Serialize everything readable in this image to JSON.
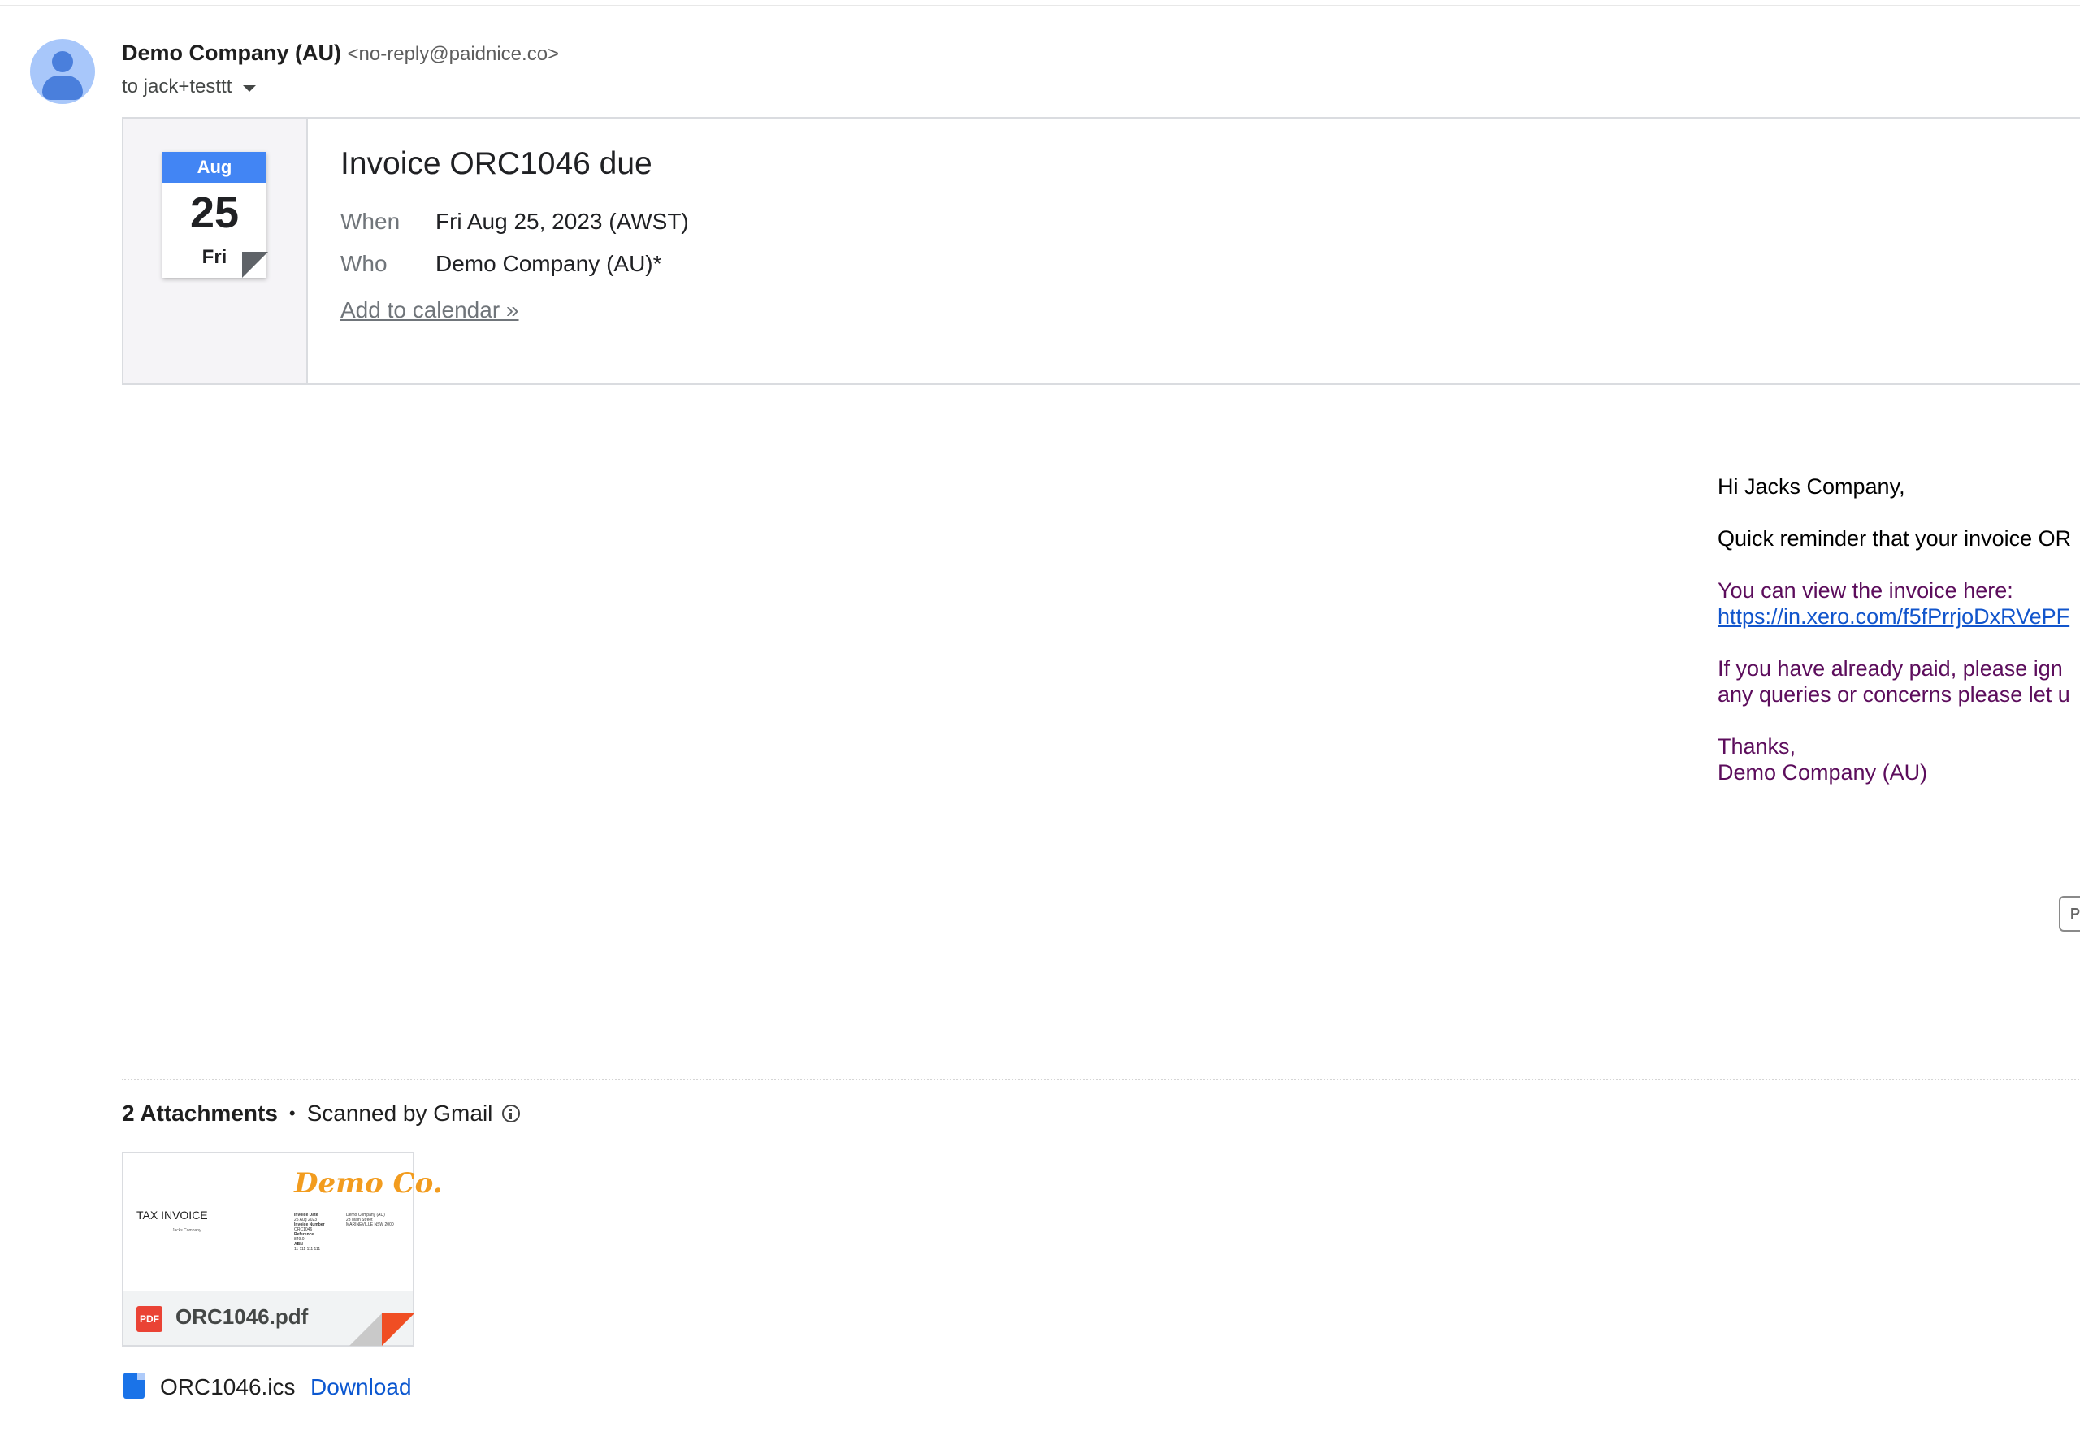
{
  "header": {
    "sender_name": "Demo Company (AU)",
    "sender_email": "<no-reply@paidnice.co>",
    "recipient_line": "to jack+testtt"
  },
  "event": {
    "calendar_month": "Aug",
    "calendar_day": "25",
    "calendar_weekday": "Fri",
    "title": "Invoice ORC1046 due",
    "when_label": "When",
    "when_value": "Fri Aug 25, 2023 (AWST)",
    "who_label": "Who",
    "who_value": "Demo Company (AU)*",
    "add_link": "Add to calendar »"
  },
  "message": {
    "greeting": "Hi Jacks Company,",
    "reminder": "Quick reminder that your invoice OR",
    "view_text": "You can view the invoice here:",
    "view_url": "https://in.xero.com/f5fPrrjoDxRVePF",
    "paid_line1": "If you have already paid, please ign",
    "paid_line2": "any queries or concerns please let u",
    "thanks": "Thanks,",
    "signature": "Demo Company (AU)",
    "cutoff_button": "P"
  },
  "attachments": {
    "count_label": "2 Attachments",
    "separator": "•",
    "scanned_label": "Scanned by Gmail",
    "pdf": {
      "badge": "PDF",
      "filename": "ORC1046.pdf",
      "preview_logo": "Demo Co.",
      "preview_title": "TAX INVOICE",
      "preview_to": "Jacks Company",
      "preview_fields": [
        "Invoice Date",
        "25 Aug 2023",
        "Invoice Number",
        "ORC1046",
        "Reference",
        "849.0",
        "ABN",
        "11 111 111 111"
      ],
      "preview_address": [
        "Demo Company (AU)",
        "23 Main Street",
        "MARINEVILLE NSW 2000"
      ]
    },
    "ics": {
      "filename": "ORC1046.ics",
      "download_label": "Download"
    }
  },
  "colors": {
    "accent_blue": "#4285f4",
    "link_blue": "#1155cc",
    "message_purple": "#5c0d5c",
    "pdf_red": "#ea4335",
    "logo_orange": "#f29c1f"
  },
  "icons": [
    "avatar-person-icon",
    "chevron-down-icon",
    "calendar-icon",
    "info-icon",
    "pdf-icon",
    "file-icon"
  ]
}
